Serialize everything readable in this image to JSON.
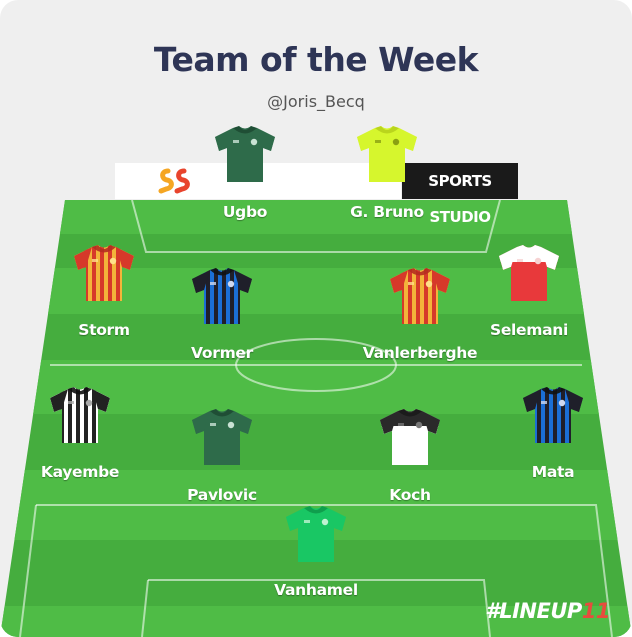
{
  "header": {
    "title": "Team of the Week",
    "handle": "@Joris_Becq"
  },
  "sponsor": {
    "text": "SPORTS STUDIO"
  },
  "branding": {
    "prefix": "#LINEUP",
    "number": "11"
  },
  "colors": {
    "pitch_light": "#4fbc46",
    "pitch_dark": "#45ad3e",
    "title": "#2e3556",
    "brand_accent": "#e84c3d"
  },
  "players": [
    {
      "name": "Ugbo",
      "kit": "green"
    },
    {
      "name": "G. Bruno",
      "kit": "lime"
    },
    {
      "name": "Storm",
      "kit": "red-yellow"
    },
    {
      "name": "Vormer",
      "kit": "blue-black"
    },
    {
      "name": "Vanlerberghe",
      "kit": "red-yellow"
    },
    {
      "name": "Selemani",
      "kit": "red-white"
    },
    {
      "name": "Kayembe",
      "kit": "black-white"
    },
    {
      "name": "Pavlovic",
      "kit": "green"
    },
    {
      "name": "Koch",
      "kit": "white-black"
    },
    {
      "name": "Mata",
      "kit": "blue-black"
    },
    {
      "name": "Vanhamel",
      "kit": "keeper-green"
    }
  ]
}
